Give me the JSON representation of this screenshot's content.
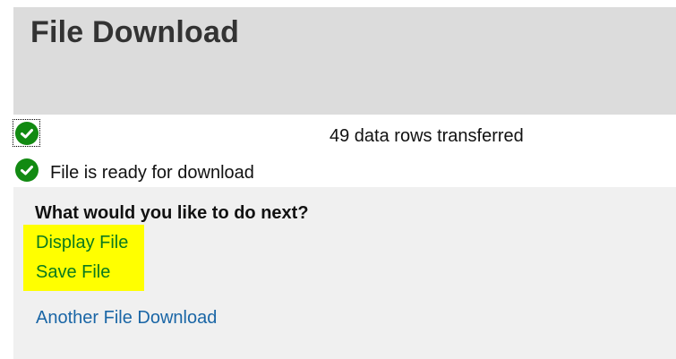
{
  "header": {
    "title": "File Download"
  },
  "status": {
    "rows_transferred": "49 data rows transferred",
    "ready_message": "File is ready for download"
  },
  "next_steps": {
    "prompt": "What would you like to do next?",
    "display_file": "Display File",
    "save_file": "Save File",
    "another_download": "Another File Download"
  },
  "colors": {
    "header_bg": "#dcdcdc",
    "panel_bg": "#f0f0f0",
    "check_green": "#128a12",
    "highlight": "#ffff00",
    "link_green": "#0b7a1e",
    "link_blue": "#1a66a6"
  },
  "icons": {
    "status_check": "check-circle-icon"
  }
}
